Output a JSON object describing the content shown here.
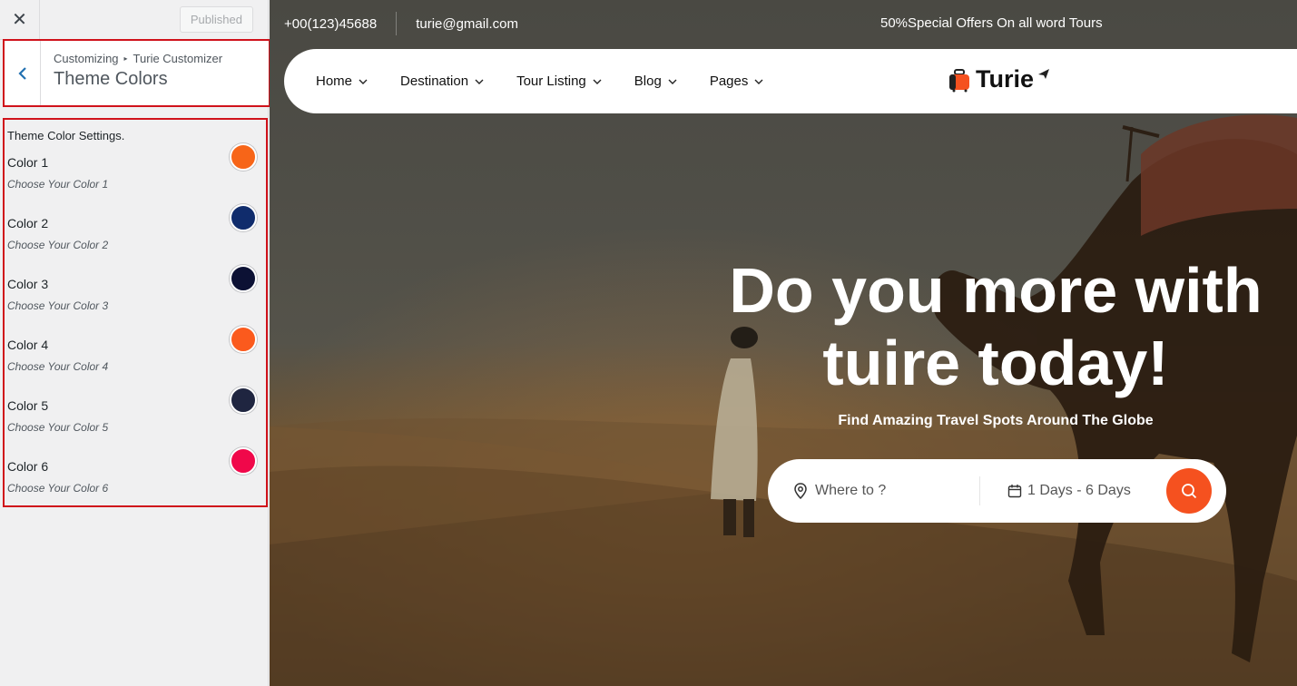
{
  "sidebar": {
    "close_icon": "close-icon",
    "publish_label": "Published",
    "breadcrumb": [
      "Customizing",
      "Turie Customizer"
    ],
    "section_title": "Theme Colors",
    "settings_description": "Theme Color Settings.",
    "colors": [
      {
        "label": "Color 1",
        "description": "Choose Your Color 1",
        "value": "#f76518"
      },
      {
        "label": "Color 2",
        "description": "Choose Your Color 2",
        "value": "#102c6c"
      },
      {
        "label": "Color 3",
        "description": "Choose Your Color 3",
        "value": "#0c1134"
      },
      {
        "label": "Color 4",
        "description": "Choose Your Color 4",
        "value": "#fb5a1d"
      },
      {
        "label": "Color 5",
        "description": "Choose Your Color 5",
        "value": "#1f2540"
      },
      {
        "label": "Color 6",
        "description": "Choose Your Color 6",
        "value": "#f0084a"
      }
    ]
  },
  "preview": {
    "topbar": {
      "phone": "+00(123)45688",
      "email": "turie@gmail.com",
      "offer": "50%Special Offers On all word Tours"
    },
    "nav": {
      "items": [
        "Home",
        "Destination",
        "Tour Listing",
        "Blog",
        "Pages"
      ],
      "logo": "Turie"
    },
    "hero": {
      "title_line1": "Do you more with",
      "title_line2": "tuire today!",
      "subtitle": "Find Amazing Travel Spots Around The Globe"
    },
    "search": {
      "where_placeholder": "Where to ?",
      "dates": "1 Days - 6 Days"
    },
    "colors": {
      "accent": "#f5511f",
      "highlight_border": "#d0121b"
    }
  }
}
